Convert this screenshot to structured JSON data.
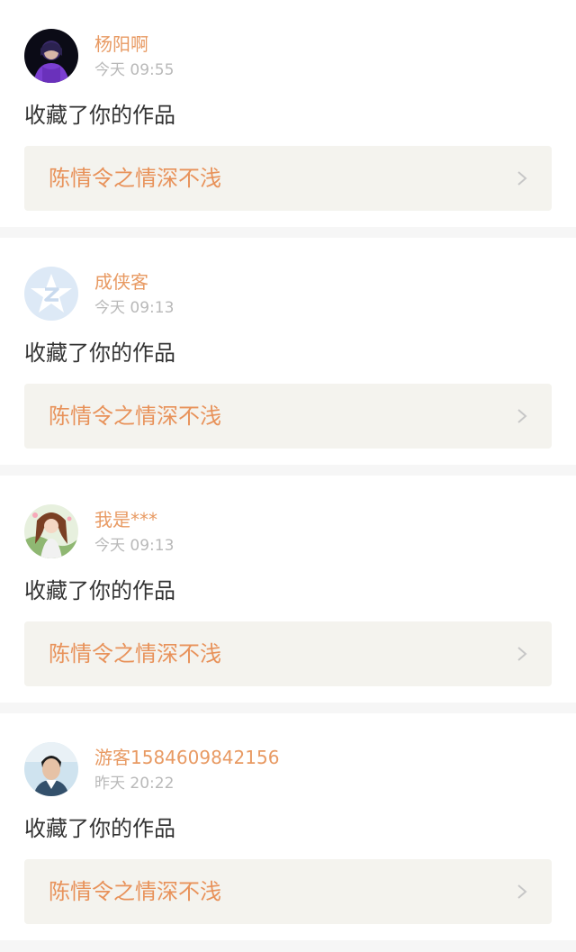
{
  "notifications": [
    {
      "username": "杨阳啊",
      "time": "今天 09:55",
      "action": "收藏了你的作品",
      "work_title": "陈情令之情深不浅",
      "avatar_icon": "user-avatar-purple-hoodie"
    },
    {
      "username": "成侠客",
      "time": "今天 09:13",
      "action": "收藏了你的作品",
      "work_title": "陈情令之情深不浅",
      "avatar_icon": "default-z-avatar-icon"
    },
    {
      "username": "我是***",
      "time": "今天 09:13",
      "action": "收藏了你的作品",
      "work_title": "陈情令之情深不浅",
      "avatar_icon": "anime-girl-avatar"
    },
    {
      "username": "游客1584609842156",
      "time": "昨天 20:22",
      "action": "收藏了你的作品",
      "work_title": "陈情令之情深不浅",
      "avatar_icon": "user-avatar-photo"
    }
  ],
  "colors": {
    "username": "#e89a63",
    "time": "#b9b9b9",
    "action": "#333333",
    "work_bg": "#f4f3ee",
    "work_title": "#e8925a",
    "page_bg": "#f6f6f6"
  }
}
